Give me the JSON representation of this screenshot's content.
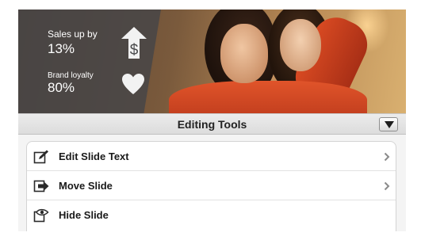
{
  "hero": {
    "stats": [
      {
        "caption": "Sales up by",
        "value": "13%",
        "icon": "dollar-up-arrow-icon"
      },
      {
        "caption": "Brand loyalty",
        "value": "80%",
        "icon": "heart-icon"
      }
    ]
  },
  "tools": {
    "title": "Editing Tools",
    "collapse_icon": "triangle-down-icon",
    "items": [
      {
        "label": "Edit Slide Text",
        "icon": "edit-pencil-icon",
        "chevron": "chevron-right-icon"
      },
      {
        "label": "Move Slide",
        "icon": "move-arrow-icon",
        "chevron": "chevron-right-icon"
      },
      {
        "label": "Hide Slide",
        "icon": "hide-eye-icon"
      }
    ]
  },
  "colors": {
    "overlay": "#464648",
    "bar": "#e4e4e4",
    "text": "#1a1a1a",
    "chevron": "#8a8a8a"
  }
}
